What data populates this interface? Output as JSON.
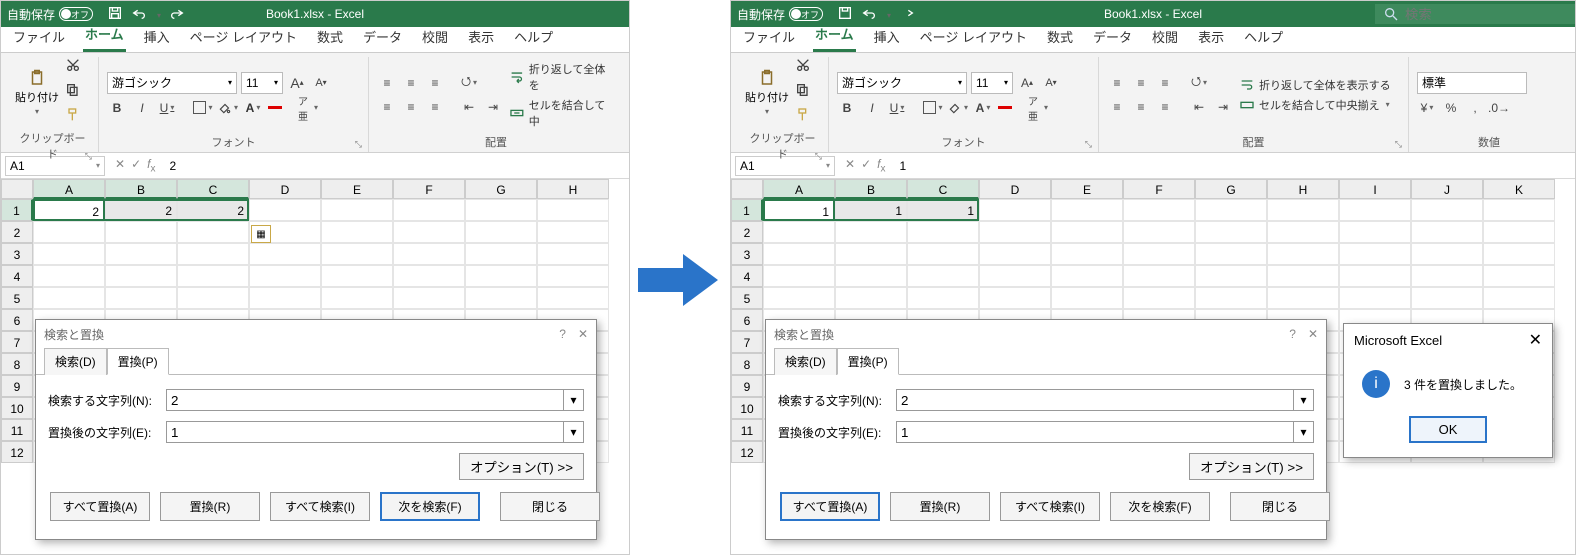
{
  "titlebar": {
    "autosave_label": "自動保存",
    "autosave_state": "オフ",
    "title": "Book1.xlsx - Excel",
    "search_placeholder": "検索"
  },
  "tabs": {
    "file": "ファイル",
    "home": "ホーム",
    "insert": "挿入",
    "pagelayout": "ページ レイアウト",
    "formulas": "数式",
    "data": "データ",
    "review": "校閲",
    "view": "表示",
    "help": "ヘルプ"
  },
  "ribbon": {
    "clipboard": {
      "paste": "貼り付け",
      "group": "クリップボード"
    },
    "font": {
      "name": "游ゴシック",
      "size": "11",
      "group": "フォント",
      "bold": "B",
      "italic": "I",
      "underline": "U",
      "increase": "A",
      "decrease": "A",
      "ruby": "ア亜"
    },
    "align": {
      "group": "配置",
      "wrap_short": "折り返して全体を",
      "wrap_full": "折り返して全体を表示する",
      "merge_short": "セルを結合して中",
      "merge_full": "セルを結合して中央揃え"
    },
    "number": {
      "group": "数値",
      "format": "標準"
    }
  },
  "formula_bar": {
    "left_name": "A1",
    "left_value": "2",
    "right_name": "A1",
    "right_value": "1"
  },
  "sheet": {
    "cols": [
      "A",
      "B",
      "C",
      "D",
      "E",
      "F",
      "G",
      "H",
      "I",
      "J",
      "K"
    ],
    "rows": [
      "1",
      "2",
      "3",
      "4",
      "5",
      "6",
      "7",
      "8",
      "9",
      "10",
      "11",
      "12"
    ],
    "left_vals": [
      "2",
      "2",
      "2"
    ],
    "right_vals": [
      "1",
      "1",
      "1"
    ]
  },
  "dialog": {
    "title": "検索と置換",
    "tab_find": "検索(D)",
    "tab_replace": "置換(P)",
    "find_label": "検索する文字列(N):",
    "replace_label": "置換後の文字列(E):",
    "find_value": "2",
    "replace_value": "1",
    "options": "オプション(T) >>",
    "btn_replace_all": "すべて置換(A)",
    "btn_replace": "置換(R)",
    "btn_find_all": "すべて検索(I)",
    "btn_find_next": "次を検索(F)",
    "btn_close": "閉じる"
  },
  "msgbox": {
    "title": "Microsoft Excel",
    "text": "3 件を置換しました。",
    "ok": "OK"
  }
}
